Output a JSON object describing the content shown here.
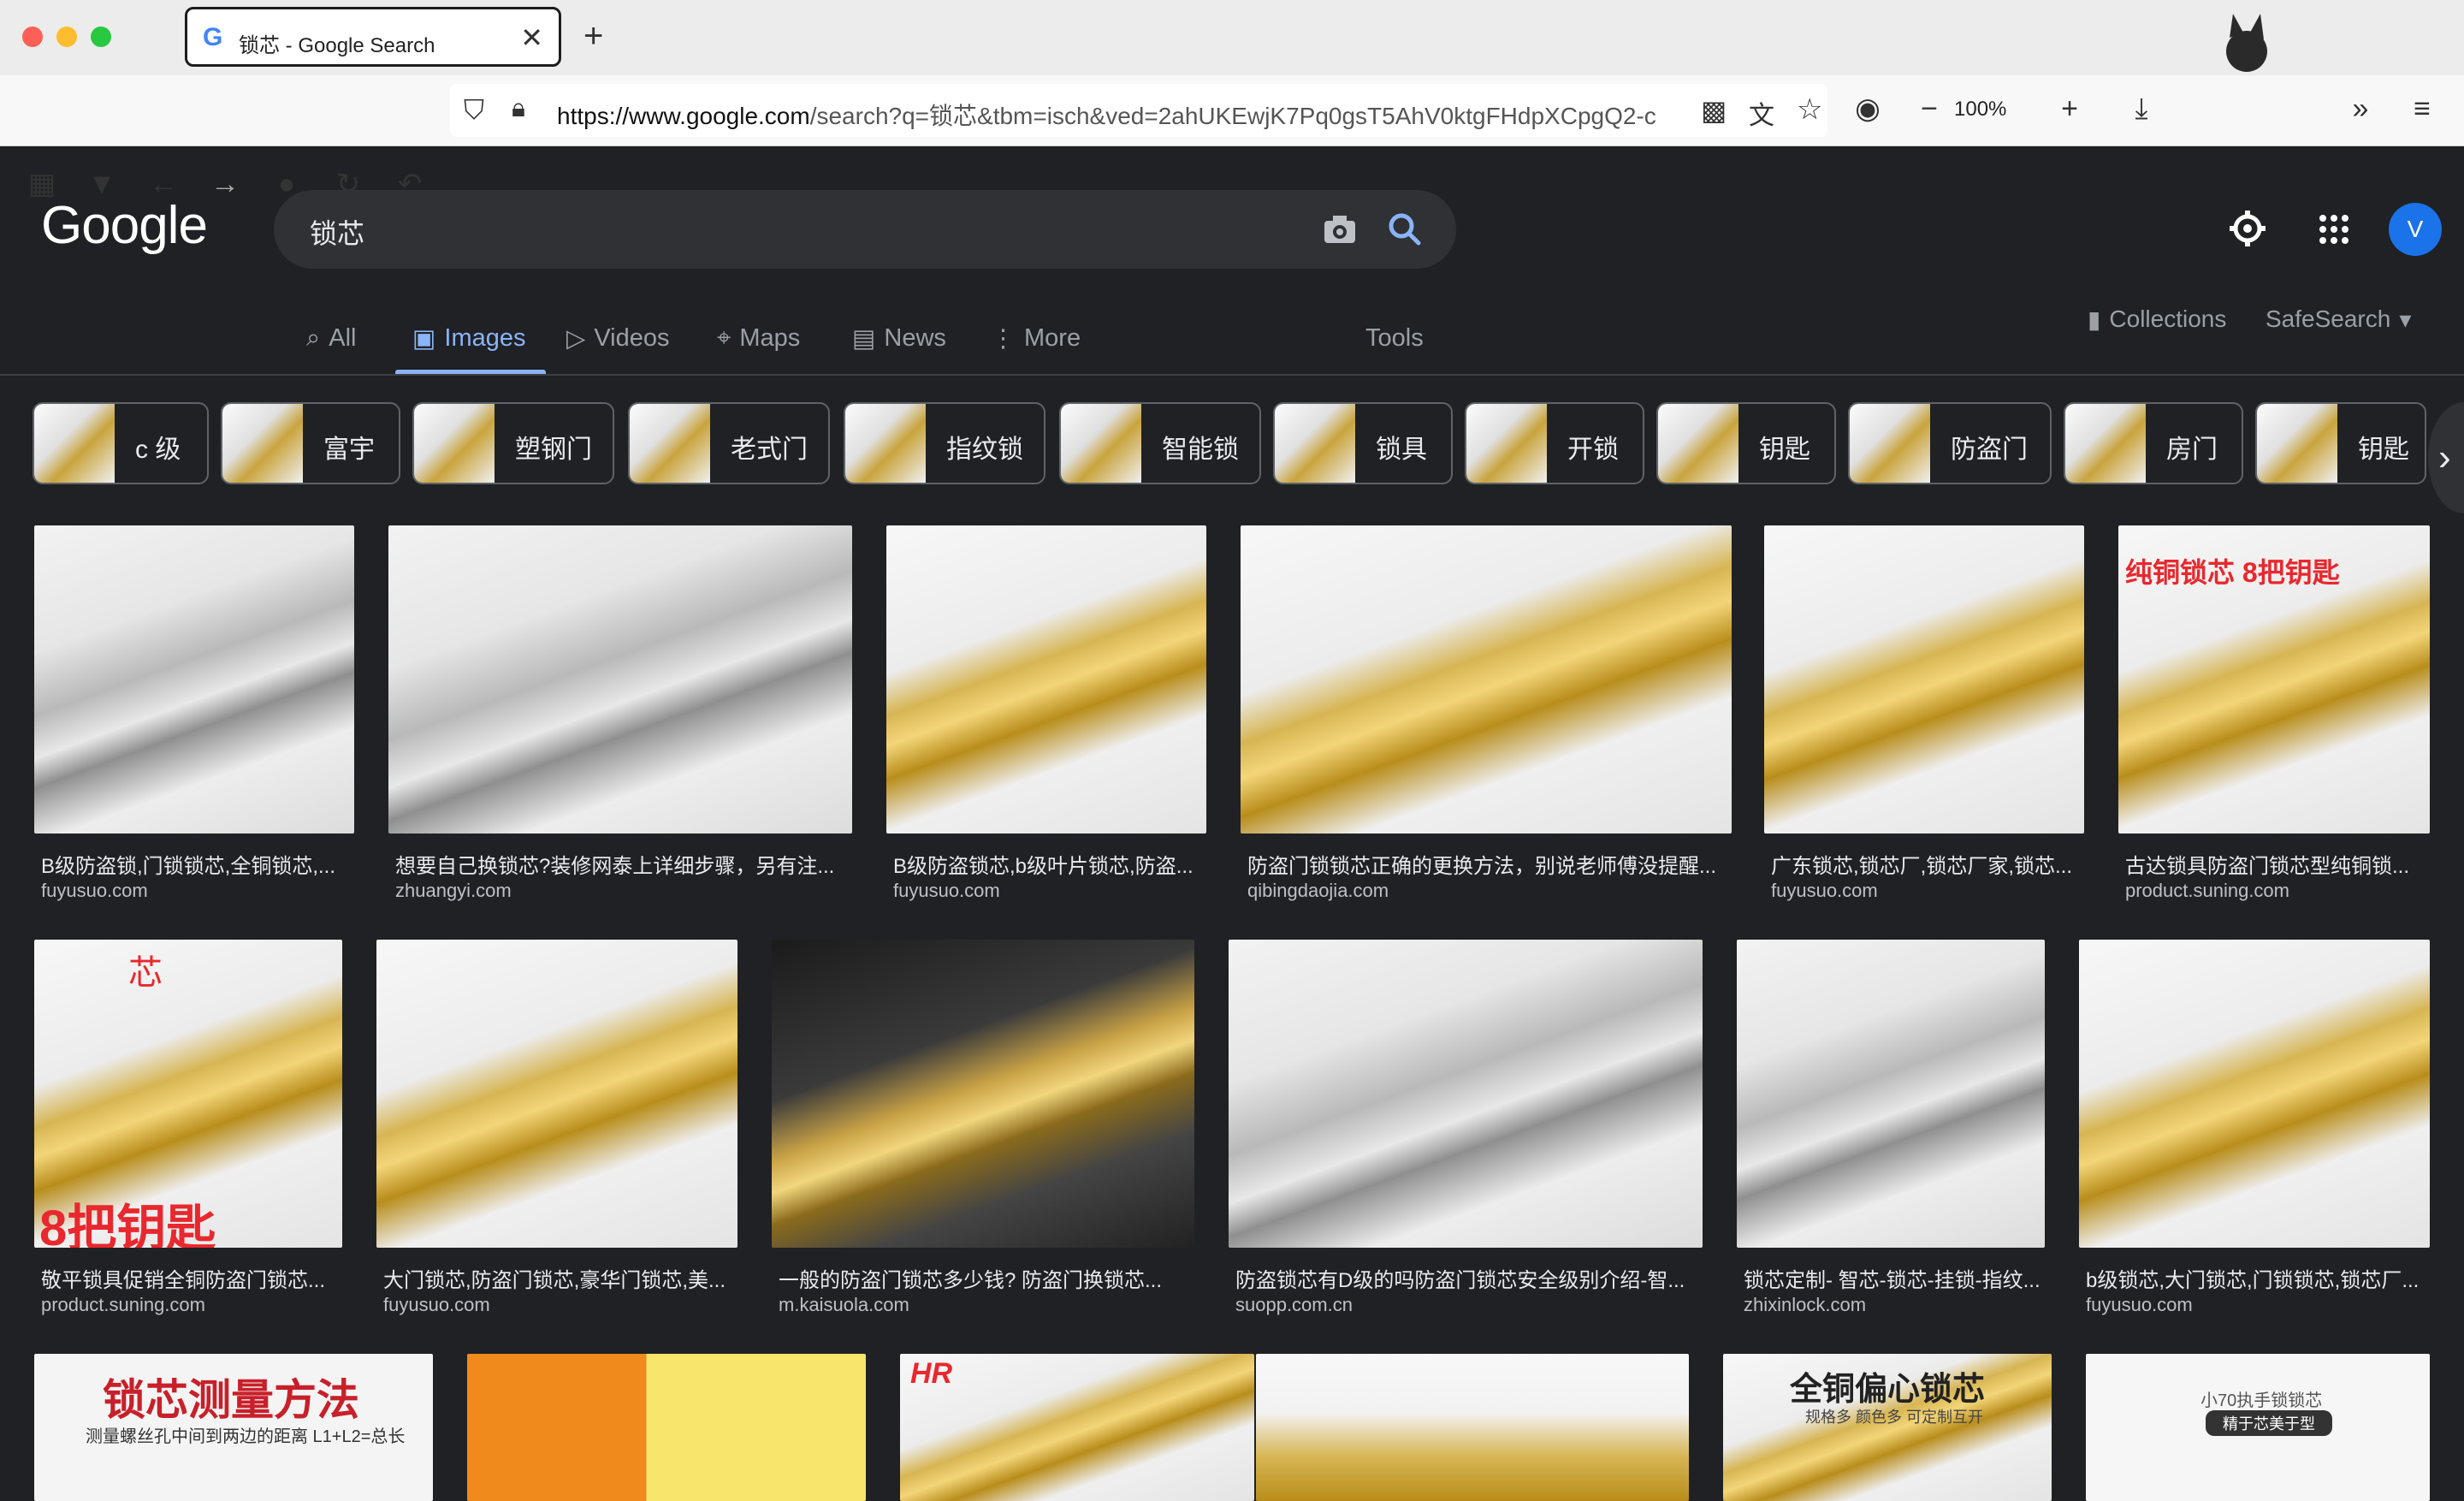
{
  "browser": {
    "tab_title": "锁芯 - Google Search",
    "new_tab": "+",
    "url_host": "https://www.google.com",
    "url_rest": "/search?q=锁芯&tbm=isch&ved=2ahUKEwjK7Pq0gsT5AhV0ktgFHdpXCpgQ2-c",
    "zoom": "100%"
  },
  "google": {
    "logo": "Google",
    "query": "锁芯",
    "avatar_letter": "V",
    "tabs": [
      {
        "label": "All",
        "icon": "search-icon"
      },
      {
        "label": "Images",
        "icon": "image-icon"
      },
      {
        "label": "Videos",
        "icon": "play-icon"
      },
      {
        "label": "Maps",
        "icon": "pin-icon"
      },
      {
        "label": "News",
        "icon": "news-icon"
      },
      {
        "label": "More",
        "icon": "more-vertical-icon"
      }
    ],
    "tools": "Tools",
    "collections": "Collections",
    "safesearch": "SafeSearch"
  },
  "chips": [
    "c 级",
    "富宇",
    "塑钢门",
    "老式门",
    "指纹锁",
    "智能锁",
    "锁具",
    "开锁",
    "钥匙",
    "防盗门",
    "房门",
    "钥匙"
  ],
  "results": [
    {
      "title": "B级防盗锁,门锁锁芯,全铜锁芯,...",
      "source": "fuyusuo.com"
    },
    {
      "title": "想要自己换锁芯?装修网泰上详细步骤，另有注...",
      "source": "zhuangyi.com"
    },
    {
      "title": "B级防盗锁芯,b级叶片锁芯,防盗...",
      "source": "fuyusuo.com"
    },
    {
      "title": "防盗门锁锁芯正确的更换方法，别说老师傅没提醒...",
      "source": "qibingdaojia.com"
    },
    {
      "title": "广东锁芯,锁芯厂,锁芯厂家,锁芯...",
      "source": "fuyusuo.com"
    },
    {
      "title": "古达锁具防盗门锁芯型纯铜锁...",
      "source": "product.suning.com"
    },
    {
      "title": "敬平锁具促销全铜防盗门锁芯...",
      "source": "product.suning.com"
    },
    {
      "title": "大门锁芯,防盗门锁芯,豪华门锁芯,美...",
      "source": "fuyusuo.com"
    },
    {
      "title": "一般的防盗门锁芯多少钱? 防盗门换锁芯...",
      "source": "m.kaisuola.com"
    },
    {
      "title": "防盗锁芯有D级的吗防盗门锁芯安全级别介绍-智...",
      "source": "suopp.com.cn"
    },
    {
      "title": "锁芯定制- 智芯-锁芯-挂锁-指纹...",
      "source": "zhixinlock.com"
    },
    {
      "title": "b级锁芯,大门锁芯,门锁锁芯,锁芯厂...",
      "source": "fuyusuo.com"
    }
  ],
  "overlays": {
    "r6": "纯铜锁芯 8把钥匙",
    "r7a": "芯",
    "r7b": "8把钥匙",
    "r13": "锁芯测量方法",
    "r13sub": "测量螺丝孔中间到两边的距离 L1+L2=总长",
    "r15": "HR",
    "r17": "全铜偏心锁芯",
    "r17sub": "规格多 颜色多 可定制互开",
    "r18": "小70执手锁锁芯",
    "r18sub": "精于芯美于型"
  }
}
